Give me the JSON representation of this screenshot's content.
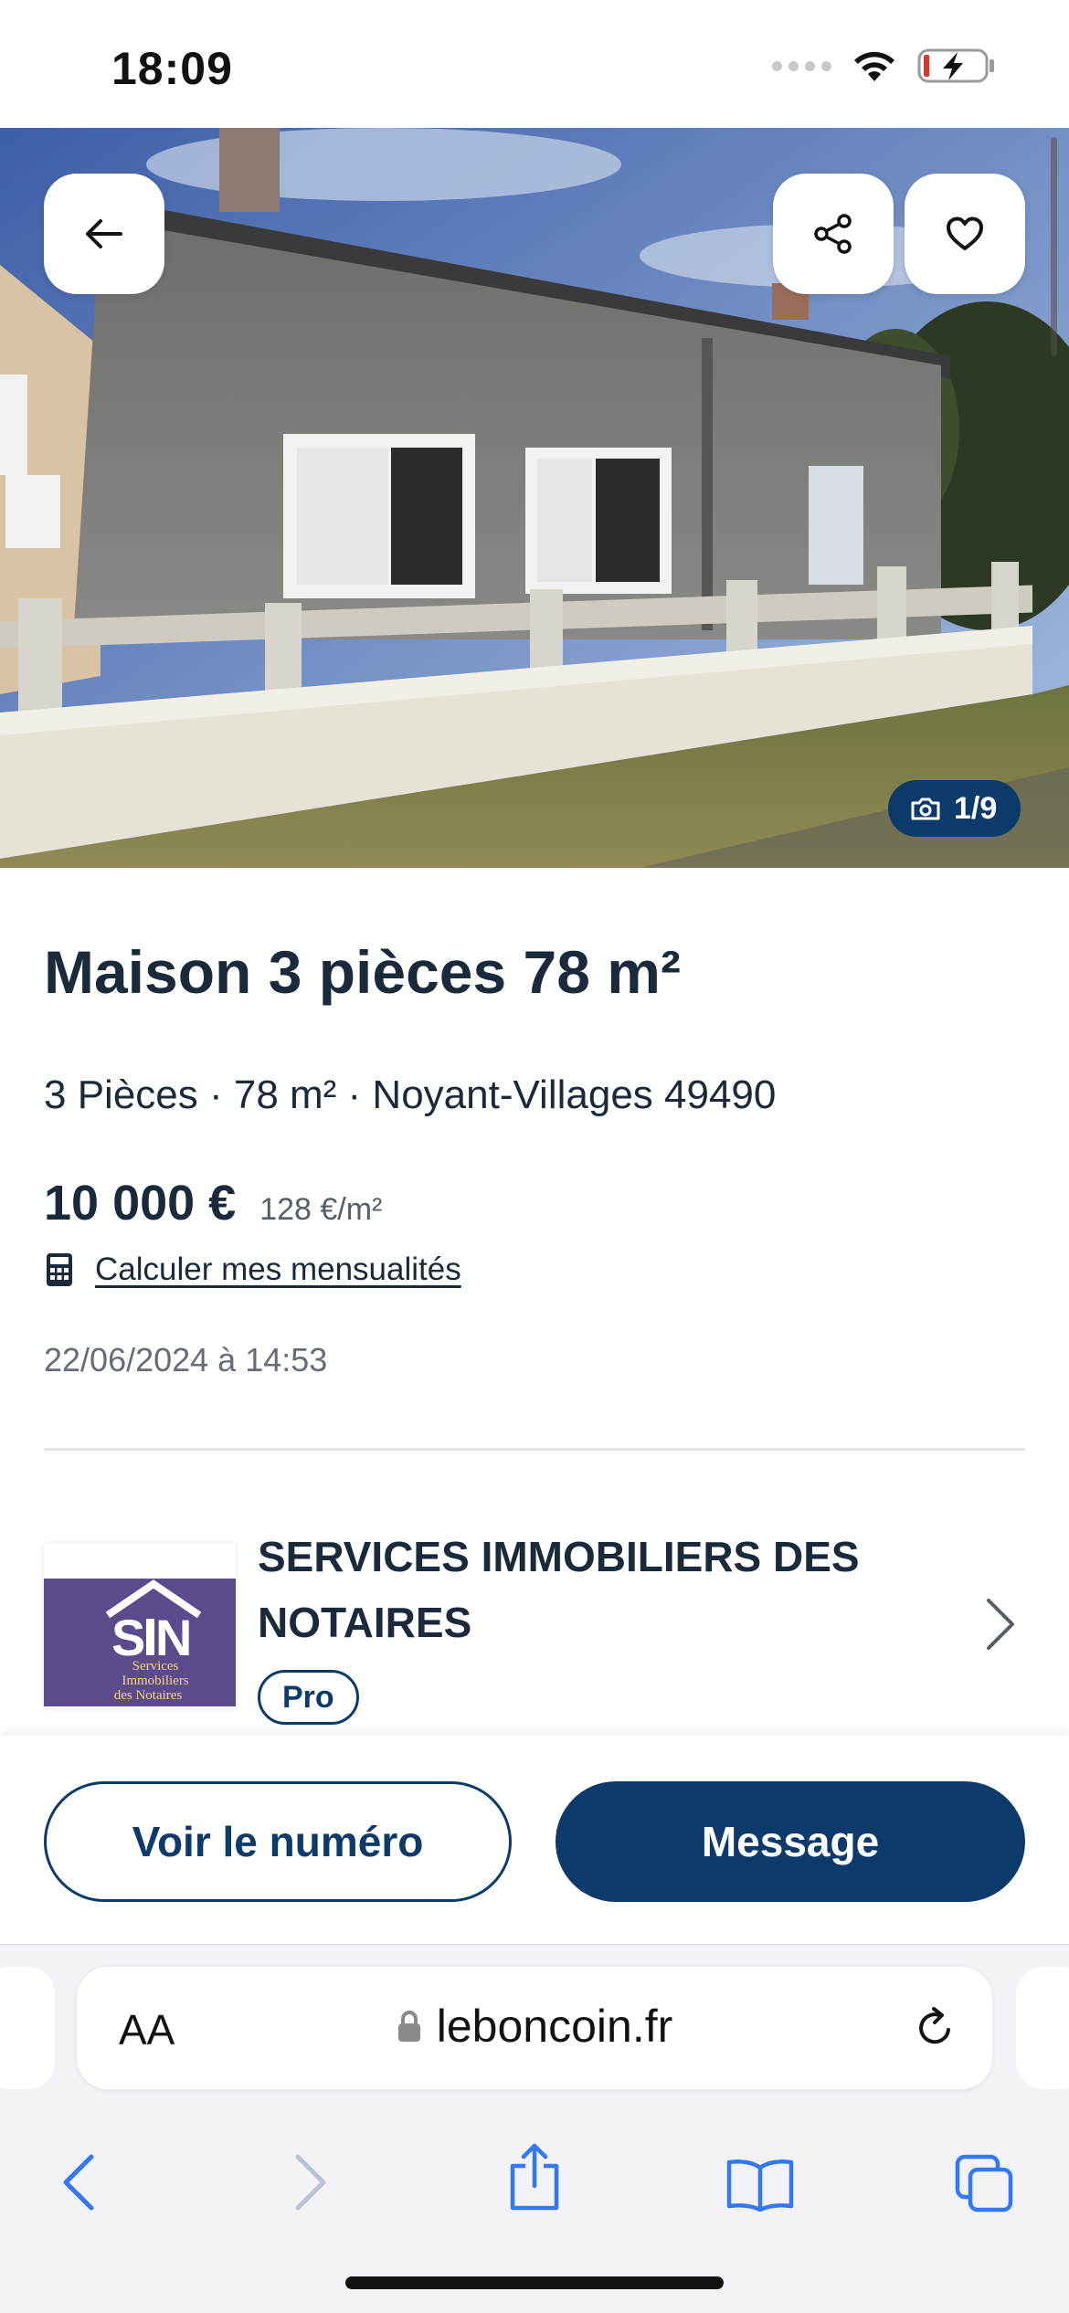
{
  "status_bar": {
    "time": "18:09"
  },
  "listing": {
    "photo_counter": "1/9",
    "title": "Maison 3 pièces 78 m²",
    "subtitle": "3 Pièces · 78 m² · Noyant-Villages 49490",
    "price": "10 000 €",
    "price_per_sqm": "128 €/m²",
    "calculate_link": "Calculer mes mensualités",
    "date": "22/06/2024 à 14:53"
  },
  "seller": {
    "name": "SERVICES IMMOBILIERS DES NOTAIRES",
    "badge": "Pro",
    "logo_text_lines": [
      "Services",
      "Immobiliers",
      "des Notaires"
    ]
  },
  "actions": {
    "show_number": "Voir le numéro",
    "message": "Message"
  },
  "browser": {
    "text_size_label": "AA",
    "url": "leboncoin.fr"
  },
  "colors": {
    "brand_navy": "#0c3a6b",
    "text_dark": "#1a2a3a",
    "ios_blue": "#3478f6"
  }
}
